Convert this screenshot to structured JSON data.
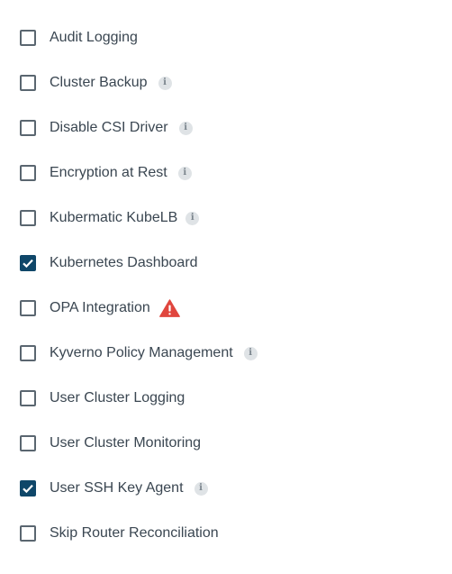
{
  "colors": {
    "checked_fill": "#0f4769",
    "checkbox_border": "#5a6670",
    "label_text": "#3a4651",
    "info_bg": "#dfe3e6",
    "warning": "#e0463e"
  },
  "options": [
    {
      "label": "Audit Logging",
      "checked": false,
      "icon": ""
    },
    {
      "label": "Cluster Backup",
      "checked": false,
      "icon": "info-icon"
    },
    {
      "label": "Disable CSI Driver",
      "checked": false,
      "icon": "info-icon"
    },
    {
      "label": "Encryption at Rest",
      "checked": false,
      "icon": "info-icon"
    },
    {
      "label": "Kubermatic KubeLB",
      "checked": false,
      "icon": "info-icon"
    },
    {
      "label": "Kubernetes Dashboard",
      "checked": true,
      "icon": ""
    },
    {
      "label": "OPA Integration",
      "checked": false,
      "icon": "warning-icon"
    },
    {
      "label": "Kyverno Policy Management",
      "checked": false,
      "icon": "info-icon"
    },
    {
      "label": "User Cluster Logging",
      "checked": false,
      "icon": ""
    },
    {
      "label": "User Cluster Monitoring",
      "checked": false,
      "icon": ""
    },
    {
      "label": "User SSH Key Agent",
      "checked": true,
      "icon": "info-icon"
    },
    {
      "label": "Skip Router Reconciliation",
      "checked": false,
      "icon": ""
    }
  ],
  "info_glyph": "i"
}
